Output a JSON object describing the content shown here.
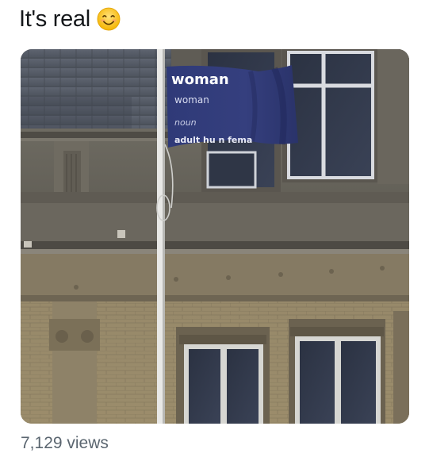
{
  "tweet": {
    "text": "It's real",
    "emoji_icon": "smiling-face-emoji"
  },
  "media": {
    "flag": {
      "title": "woman",
      "line1": "woman",
      "line2": "noun",
      "line3": "adult hu    n fema"
    }
  },
  "stats": {
    "views": "7,129 views"
  }
}
